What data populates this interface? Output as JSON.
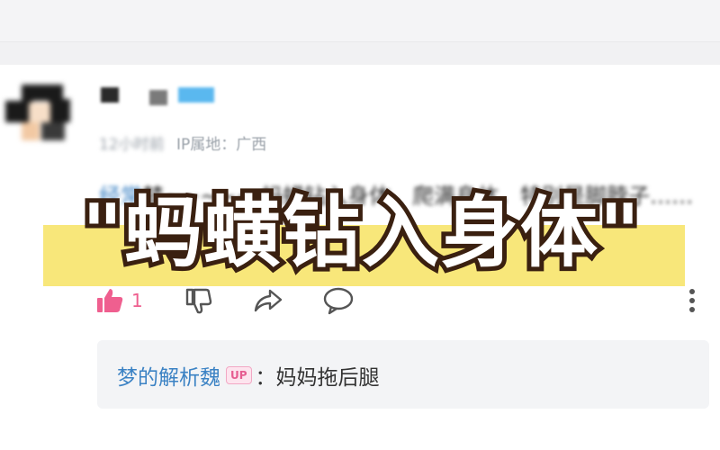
{
  "meta": {
    "time": "12小时前",
    "ip_location": "IP属地：广西"
  },
  "comment": {
    "mention": "经常",
    "text": "梦~~~~~ 蚂蟥钻入身体，爬满身体，特别是脚脖子……"
  },
  "overlay": {
    "title": "\"蚂蟥钻入身体\""
  },
  "actions": {
    "like_count": "1",
    "like_icon": "thumbs-up-icon",
    "dislike_icon": "thumbs-down-icon",
    "share_icon": "share-icon",
    "reply_icon": "comment-icon",
    "more_icon": "more-icon"
  },
  "reply": {
    "author": "梦的解析魏",
    "badge": "UP",
    "separator": "：",
    "text": "妈妈拖后腿"
  },
  "colors": {
    "accent_pink": "#ef5f8f",
    "link_blue": "#3b82c4",
    "highlight_yellow": "#f8e77a",
    "overlay_stroke": "#3a2010"
  }
}
